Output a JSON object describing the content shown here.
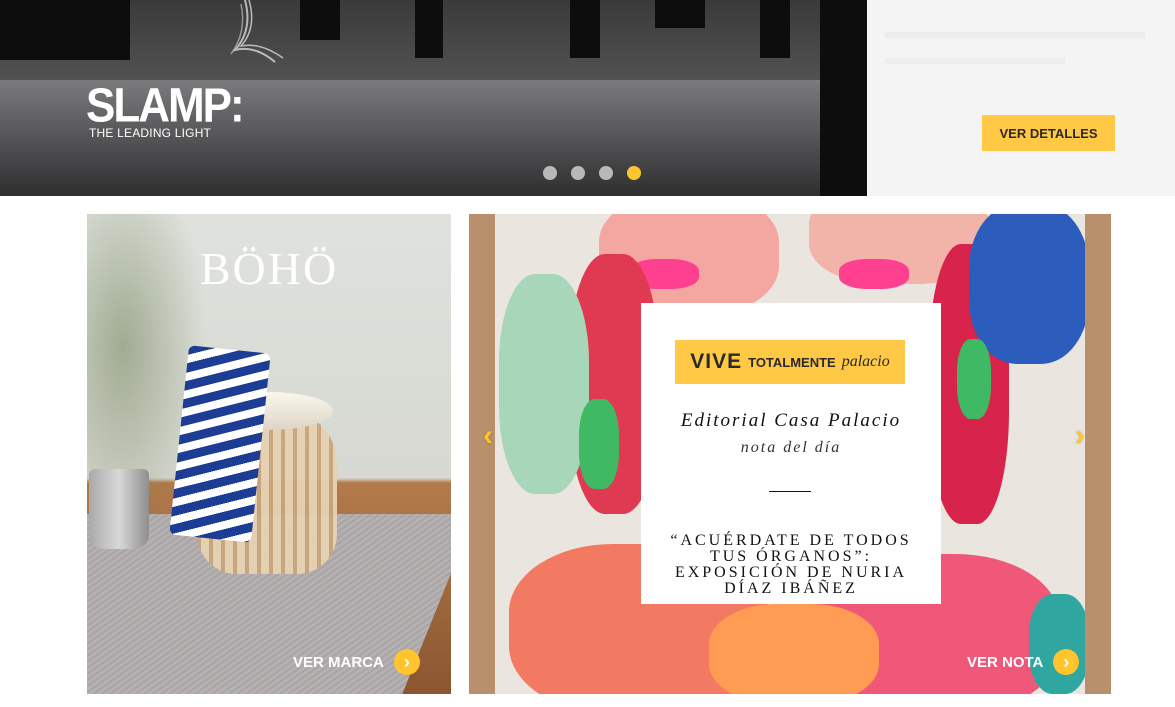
{
  "hero": {
    "brand": "SLAMP",
    "brand_mark": ":",
    "tagline": "THE LEADING LIGHT",
    "slides": 4,
    "active_slide": 4,
    "cta_label": "VER DETALLES"
  },
  "boho_card": {
    "title": "BÖHÖ",
    "link_label": "VER MARCA"
  },
  "editorial": {
    "badge_vive": "VIVE",
    "badge_totalmente": "TOTALMENTE",
    "badge_palacio": "palacio",
    "title": "Editorial Casa Palacio",
    "subtitle": "nota del día",
    "headline": "“ACUÉRDATE DE TODOS TUS ÓRGANOS”: EXPOSICIÓN DE NURIA DÍAZ IBÁÑEZ",
    "link_label": "VER NOTA",
    "prev_icon": "‹",
    "next_icon": "›"
  },
  "colors": {
    "accent": "#ffc42e",
    "button": "#ffc845"
  }
}
